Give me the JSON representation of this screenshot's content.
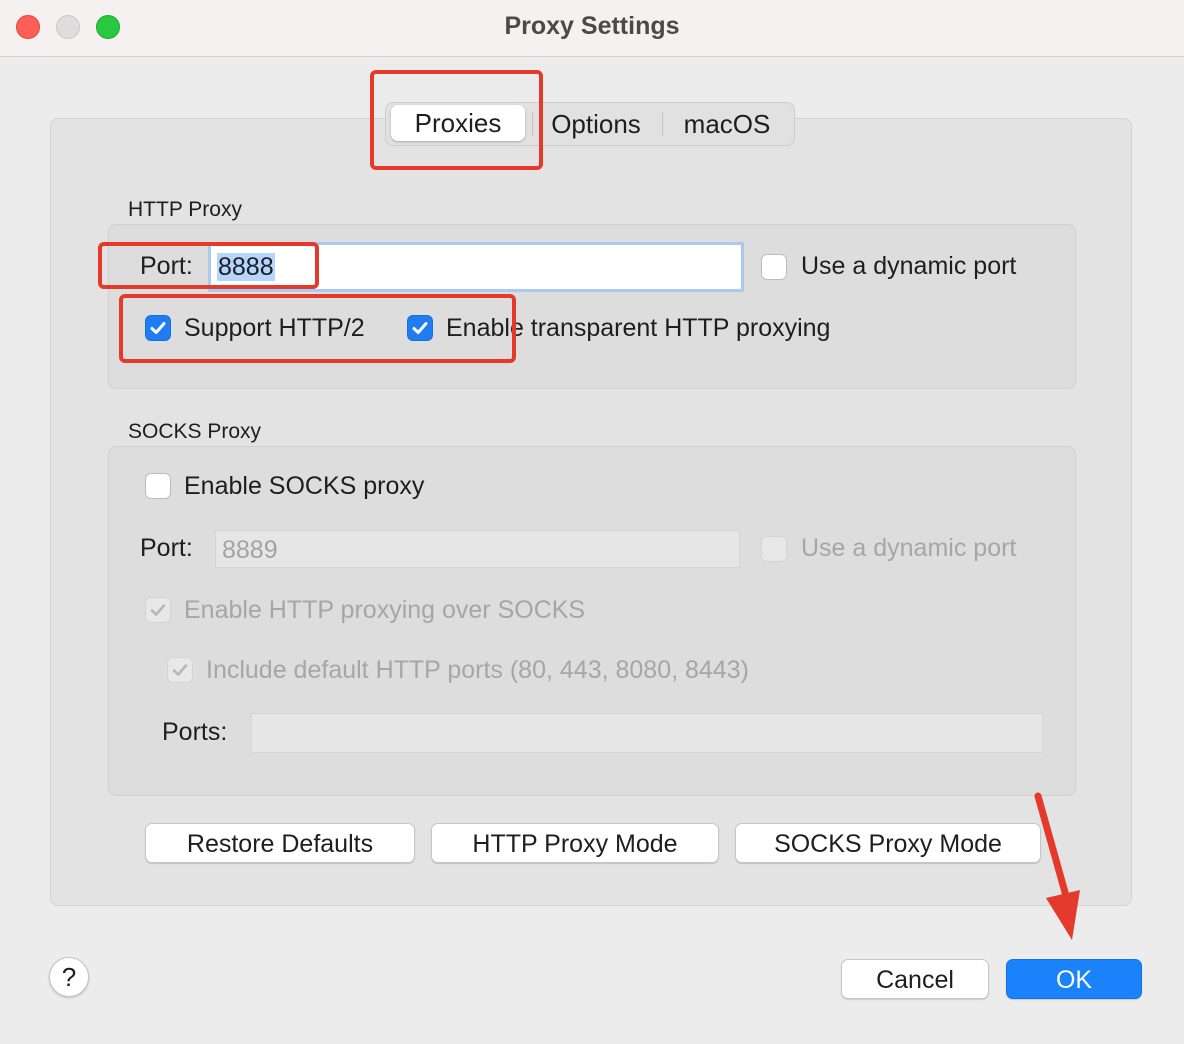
{
  "window": {
    "title": "Proxy Settings"
  },
  "tabs": [
    {
      "label": "Proxies",
      "selected": true
    },
    {
      "label": "Options",
      "selected": false
    },
    {
      "label": "macOS",
      "selected": false
    }
  ],
  "http_proxy": {
    "group_label": "HTTP Proxy",
    "port_label": "Port:",
    "port_value": "8888",
    "dynamic_port_label": "Use a dynamic port",
    "dynamic_port_checked": false,
    "support_http2_label": "Support HTTP/2",
    "support_http2_checked": true,
    "transparent_label": "Enable transparent HTTP proxying",
    "transparent_checked": true
  },
  "socks_proxy": {
    "group_label": "SOCKS Proxy",
    "enable_label": "Enable SOCKS proxy",
    "enable_checked": false,
    "port_label": "Port:",
    "port_value": "8889",
    "dynamic_port_label": "Use a dynamic port",
    "dynamic_port_checked": false,
    "http_over_socks_label": "Enable HTTP proxying over SOCKS",
    "http_over_socks_checked": true,
    "include_default_ports_label": "Include default HTTP ports (80, 443, 8080, 8443)",
    "include_default_ports_checked": true,
    "ports_label": "Ports:",
    "ports_value": ""
  },
  "buttons": {
    "restore_defaults": "Restore Defaults",
    "http_proxy_mode": "HTTP Proxy Mode",
    "socks_proxy_mode": "SOCKS Proxy Mode",
    "cancel": "Cancel",
    "ok": "OK",
    "help": "?"
  },
  "colors": {
    "accent": "#1a82fb",
    "annotation": "#e43a2c"
  }
}
